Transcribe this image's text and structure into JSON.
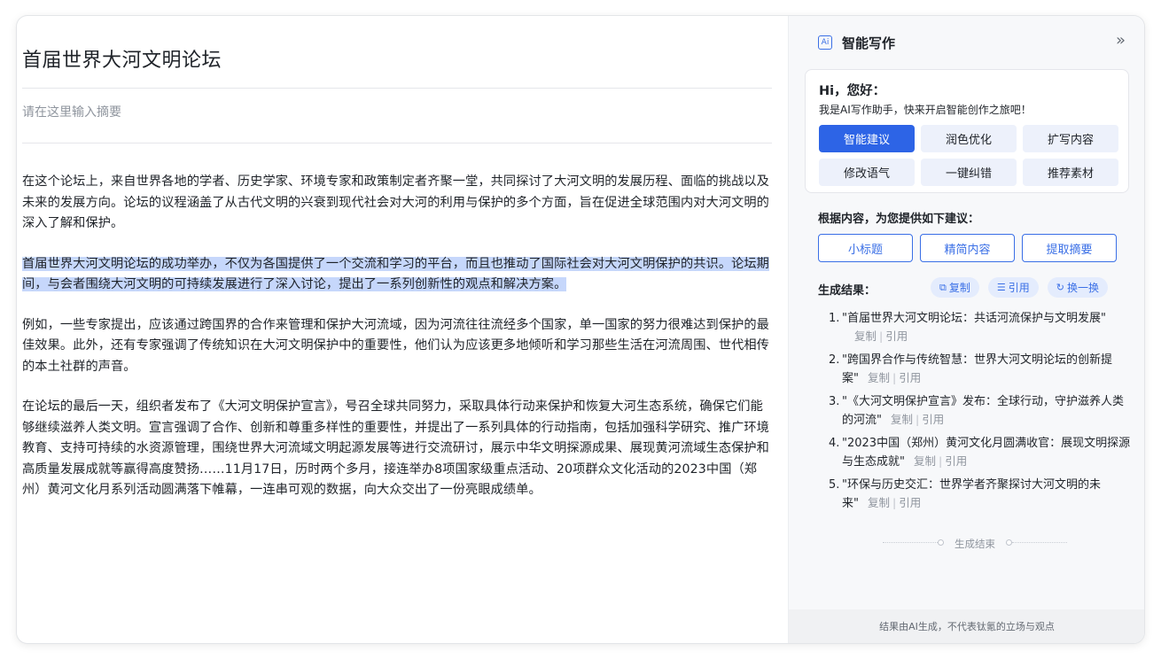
{
  "editor": {
    "title": "首届世界大河文明论坛",
    "abstract_placeholder": "请在这里输入摘要",
    "paragraphs": [
      "在这个论坛上，来自世界各地的学者、历史学家、环境专家和政策制定者齐聚一堂，共同探讨了大河文明的发展历程、面临的挑战以及未来的发展方向。论坛的议程涵盖了从古代文明的兴衰到现代社会对大河的利用与保护的多个方面，旨在促进全球范围内对大河文明的深入了解和保护。",
      "首届世界大河文明论坛的成功举办，不仅为各国提供了一个交流和学习的平台，而且也推动了国际社会对大河文明保护的共识。论坛期间，与会者围绕大河文明的可持续发展进行了深入讨论，提出了一系列创新性的观点和解决方案。",
      "例如，一些专家提出，应该通过跨国界的合作来管理和保护大河流域，因为河流往往流经多个国家，单一国家的努力很难达到保护的最佳效果。此外，还有专家强调了传统知识在大河文明保护中的重要性，他们认为应该更多地倾听和学习那些生活在河流周围、世代相传的本土社群的声音。",
      "在论坛的最后一天，组织者发布了《大河文明保护宣言》，号召全球共同努力，采取具体行动来保护和恢复大河生态系统，确保它们能够继续滋养人类文明。宣言强调了合作、创新和尊重多样性的重要性，并提出了一系列具体的行动指南，包括加强科学研究、推广环境教育、支持可持续的水资源管理，围绕世界大河流域文明起源发展等进行交流研讨，展示中华文明探源成果、展现黄河流域生态保护和高质量发展成就等赢得高度赞扬……11月17日，历时两个多月，接连举办8项国家级重点活动、20项群众文化活动的2023中国（郑州）黄河文化月系列活动圆满落下帷幕，一连串可观的数据，向大众交出了一份亮眼成绩单。"
    ],
    "highlighted_paragraph_index": 1
  },
  "panel": {
    "icon": "ai-icon",
    "icon_text": "Ai",
    "title": "智能写作",
    "collapse_glyph": "»",
    "greeting_title": "Hi，您好：",
    "greeting_sub": "我是AI写作助手，快来开启智能创作之旅吧！",
    "actions": [
      "智能建议",
      "润色优化",
      "扩写内容",
      "修改语气",
      "一键纠错",
      "推荐素材"
    ],
    "active_action": "智能建议",
    "suggest_label": "根据内容，为您提供如下建议：",
    "suggestions": [
      "小标题",
      "精简内容",
      "提取摘要"
    ],
    "result_label": "生成结果：",
    "tools": {
      "copy": "复制",
      "quote": "引用",
      "refresh": "换一换"
    },
    "results": [
      {
        "num": "1.",
        "text": "\"首届世界大河文明论坛：共话河流保护与文明发展\""
      },
      {
        "num": "2.",
        "text": "\"跨国界合作与传统智慧：世界大河文明论坛的创新提案\""
      },
      {
        "num": "3.",
        "text": "\"《大河文明保护宣言》发布：全球行动，守护滋养人类的河流\""
      },
      {
        "num": "4.",
        "text": "\"2023中国（郑州）黄河文化月圆满收官：展现文明探源与生态成就\""
      },
      {
        "num": "5.",
        "text": "\"环保与历史交汇：世界学者齐聚探讨大河文明的未来\""
      }
    ],
    "result_copy": "复制",
    "result_quote": "引用",
    "end_text": "生成结束",
    "footer": "结果由AI生成，不代表钛氪的立场与观点"
  },
  "colors": {
    "accent": "#2d64e6",
    "highlight": "#c6d7fb"
  }
}
